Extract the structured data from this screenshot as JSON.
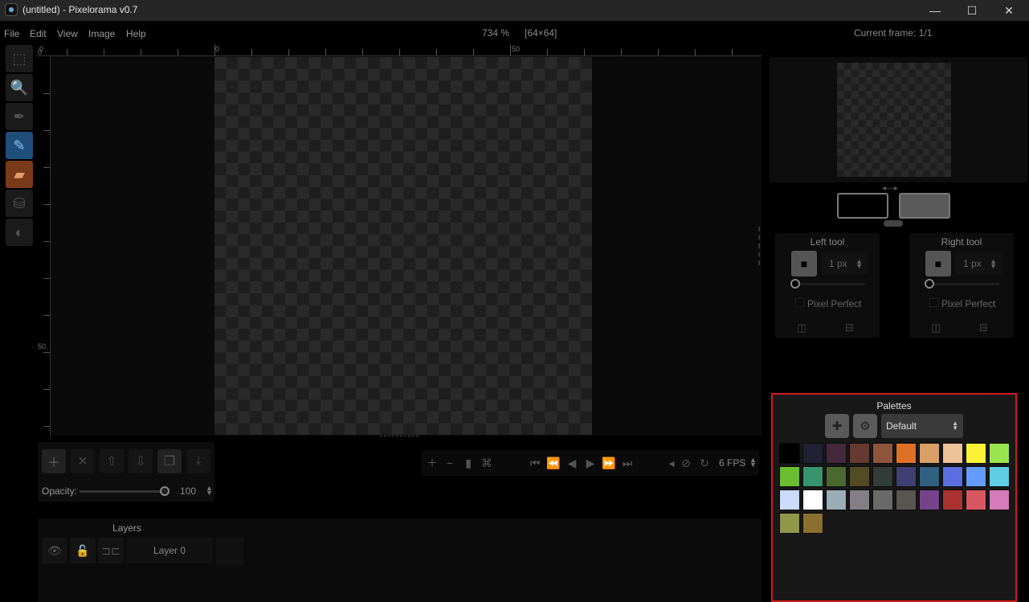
{
  "window": {
    "title": "(untitled) - Pixelorama v0.7",
    "minimize": "—",
    "maximize": "☐",
    "close": "✕"
  },
  "menu": {
    "items": [
      "File",
      "Edit",
      "View",
      "Image",
      "Help"
    ],
    "zoom": "734 %",
    "canvas_size": "[64×64]",
    "current_frame": "Current frame: 1/1"
  },
  "tools": [
    {
      "name": "rect-select",
      "icon": "⬚"
    },
    {
      "name": "zoom",
      "icon": "🔍"
    },
    {
      "name": "color-picker",
      "icon": "✒"
    },
    {
      "name": "pencil",
      "icon": "✎"
    },
    {
      "name": "eraser",
      "icon": "▰"
    },
    {
      "name": "bucket",
      "icon": "⛁"
    },
    {
      "name": "lighten-darken",
      "icon": "◐"
    }
  ],
  "rulers": {
    "top": [
      "0",
      "0",
      "50"
    ],
    "left": [
      "0",
      "50"
    ]
  },
  "layer_toolbar": {
    "opacity_label": "Opacity:",
    "opacity_value": "100",
    "opacity": 100
  },
  "animation": {
    "fps": "6 FPS"
  },
  "layers": {
    "header": "Layers",
    "items": [
      {
        "name": "Layer 0"
      }
    ]
  },
  "tool_options": {
    "left": {
      "title": "Left tool",
      "size": "1 px",
      "pixel_perfect": "Pixel Perfect"
    },
    "right": {
      "title": "Right tool",
      "size": "1 px",
      "pixel_perfect": "Pixel Perfect"
    }
  },
  "colors": {
    "left_color": "#000000",
    "right_color": "#5a5a5a"
  },
  "palettes": {
    "title": "Palettes",
    "selected": "Default",
    "swatches": [
      "#000000",
      "#222034",
      "#45283c",
      "#663931",
      "#8f563b",
      "#df7126",
      "#d9a066",
      "#eec39a",
      "#fbf236",
      "#99e550",
      "#6abe30",
      "#37946e",
      "#4b692f",
      "#524b24",
      "#323c39",
      "#3f3f74",
      "#306082",
      "#5b6ee1",
      "#639bff",
      "#5fcde4",
      "#cbdbfc",
      "#ffffff",
      "#9badb7",
      "#847e87",
      "#696a6a",
      "#595652",
      "#76428a",
      "#ac3232",
      "#d95763",
      "#d77bba",
      "#8f974a",
      "#8a6f30"
    ]
  }
}
